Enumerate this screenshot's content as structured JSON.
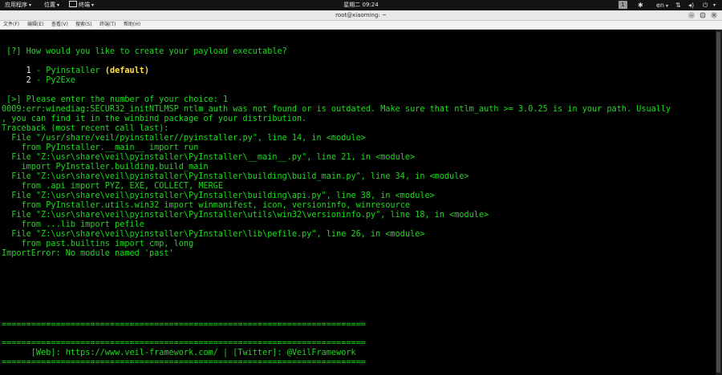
{
  "topbar": {
    "applications": "应用程序",
    "places": "位置",
    "terminal": "终端",
    "clock": "星期二 09:24",
    "workspace": "1",
    "lang": "en"
  },
  "window": {
    "title": "root@xiaoming: ~"
  },
  "menubar": [
    "文件(F)",
    "编辑(E)",
    "查看(V)",
    "搜索(S)",
    "终端(T)",
    "帮助(H)"
  ],
  "terminal": {
    "question": " [?] How would you like to create your payload executable?",
    "opt1_num": "     1",
    "opt1_text": " - Pyinstaller ",
    "opt1_default": "(default)",
    "opt2_num": "     2",
    "opt2_text": " - Py2Exe",
    "prompt": " [>] Please enter the number of your choice: 1",
    "err1": "0009:err:winediag:SECUR32_initNTLMSP ntlm_auth was not found or is outdated. Make sure that ntlm_auth >= 3.0.25 is in your path. Usually",
    "err2": ", you can find it in the winbind package of your distribution.",
    "tb0": "Traceback (most recent call last):",
    "tb1": "  File \"/usr/share/veil/pyinstaller//pyinstaller.py\", line 14, in <module>",
    "tb2": "    from PyInstaller.__main__ import run",
    "tb3": "  File \"Z:\\usr\\share\\veil\\pyinstaller\\PyInstaller\\__main__.py\", line 21, in <module>",
    "tb4": "    import PyInstaller.building.build_main",
    "tb5": "  File \"Z:\\usr\\share\\veil\\pyinstaller\\PyInstaller\\building\\build_main.py\", line 34, in <module>",
    "tb6": "    from .api import PYZ, EXE, COLLECT, MERGE",
    "tb7": "  File \"Z:\\usr\\share\\veil\\pyinstaller\\PyInstaller\\building\\api.py\", line 38, in <module>",
    "tb8": "    from PyInstaller.utils.win32 import winmanifest, icon, versioninfo, winresource",
    "tb9": "  File \"Z:\\usr\\share\\veil\\pyinstaller\\PyInstaller\\utils\\win32\\versioninfo.py\", line 18, in <module>",
    "tb10": "    from ...lib import pefile",
    "tb11": "  File \"Z:\\usr\\share\\veil\\pyinstaller\\PyInstaller\\lib\\pefile.py\", line 26, in <module>",
    "tb12": "    from past.builtins import cmp, long",
    "tb13": "ImportError: No module named 'past'",
    "sep1": "==========================================================================",
    "sep2": "==========================================================================",
    "footer": "      [Web]: https://www.veil-framework.com/ | [Twitter]: @VeilFramework",
    "sep3": "=========================================================================="
  }
}
